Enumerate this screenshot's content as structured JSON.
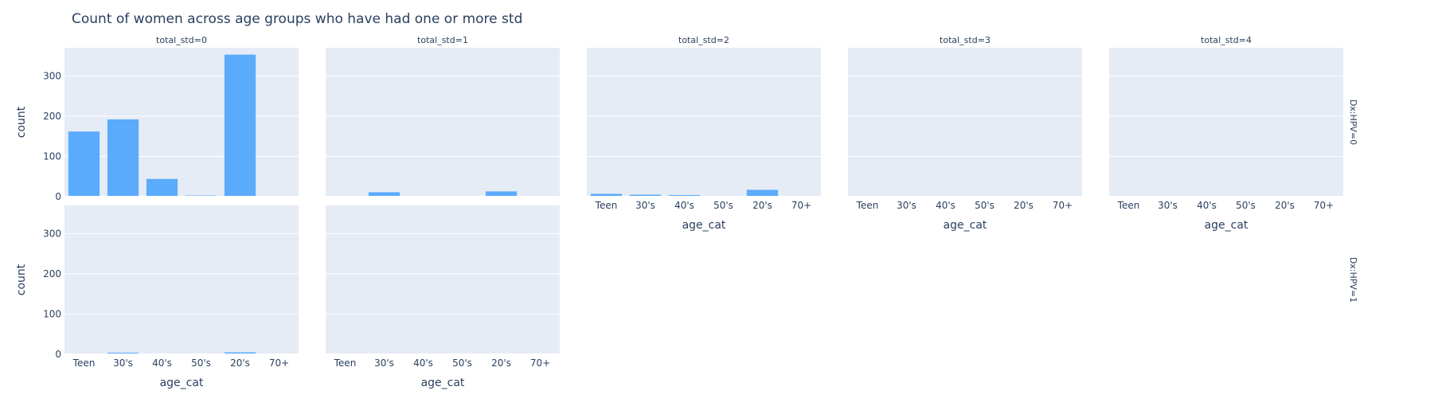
{
  "chart_data": {
    "type": "bar",
    "title": "Count of women across age groups who have had one or more std",
    "xlabel": "age_cat",
    "ylabel": "count",
    "categories": [
      "Teen",
      "30's",
      "40's",
      "50's",
      "20's",
      "70+"
    ],
    "ylim": [
      0,
      370
    ],
    "yticks": [
      0,
      100,
      200,
      300
    ],
    "grid": true,
    "colors": {
      "bar": "#636efa",
      "bar_display": "#5aabfb",
      "plot_bg": "#e5ecf6",
      "grid": "#ffffff",
      "text": "#2a3f5f"
    },
    "column_facets": [
      "total_std=0",
      "total_std=1",
      "total_std=2",
      "total_std=3",
      "total_std=4"
    ],
    "row_facets": [
      "Dx:HPV=0",
      "Dx:HPV=1"
    ],
    "panels": [
      {
        "row": 0,
        "col": 0,
        "column_label": "total_std=0",
        "row_label": "Dx:HPV=0",
        "values": [
          162,
          192,
          44,
          3,
          353,
          2
        ]
      },
      {
        "row": 0,
        "col": 1,
        "column_label": "total_std=1",
        "row_label": "Dx:HPV=0",
        "values": [
          2,
          11,
          2,
          0,
          13,
          0
        ]
      },
      {
        "row": 0,
        "col": 2,
        "column_label": "total_std=2",
        "row_label": "Dx:HPV=0",
        "values": [
          7,
          5,
          4,
          0,
          17,
          0
        ]
      },
      {
        "row": 0,
        "col": 3,
        "column_label": "total_std=3",
        "row_label": "Dx:HPV=0",
        "values": [
          2,
          1,
          0,
          0,
          1,
          0
        ]
      },
      {
        "row": 0,
        "col": 4,
        "column_label": "total_std=4",
        "row_label": "Dx:HPV=0",
        "values": [
          1,
          0,
          0,
          0,
          0,
          0
        ]
      },
      {
        "row": 1,
        "col": 0,
        "column_label": "total_std=0",
        "row_label": "Dx:HPV=1",
        "values": [
          1,
          4,
          2,
          1,
          5,
          1
        ]
      },
      {
        "row": 1,
        "col": 1,
        "column_label": "total_std=1",
        "row_label": "Dx:HPV=1",
        "values": [
          0,
          1,
          0,
          0,
          0,
          0
        ]
      }
    ]
  }
}
